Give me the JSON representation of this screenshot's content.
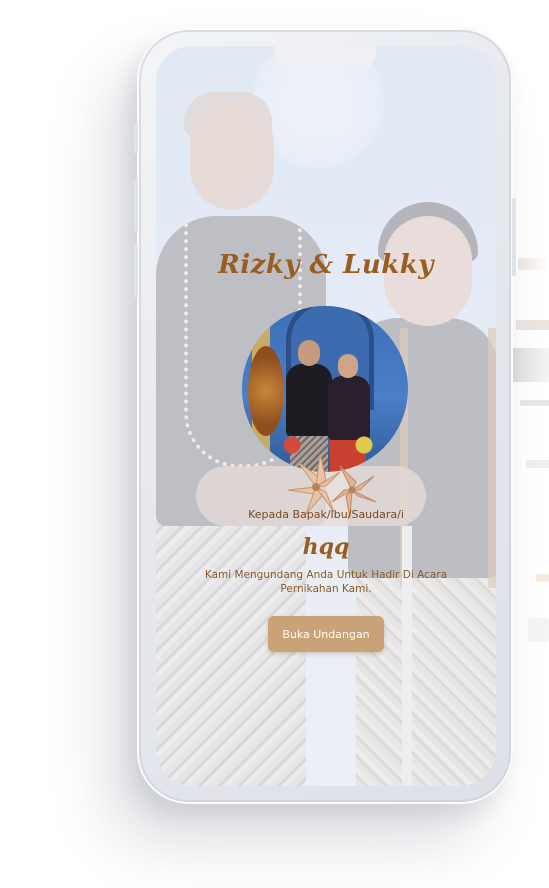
{
  "invitation": {
    "couple_title": "Rizky & Lukky",
    "greeting": "Kepada Bapak/Ibu/Saudara/i",
    "guest_name": "hqq",
    "message": "Kami Mengundang Anda Untuk Hadir Di Acara Pernikahan Kami.",
    "open_button_label": "Buka Undangan"
  },
  "colors": {
    "accent_text": "#9a5d1f",
    "button_bg": "#c9a277"
  },
  "icons": {
    "decoration": "flower-ornament-icon"
  }
}
